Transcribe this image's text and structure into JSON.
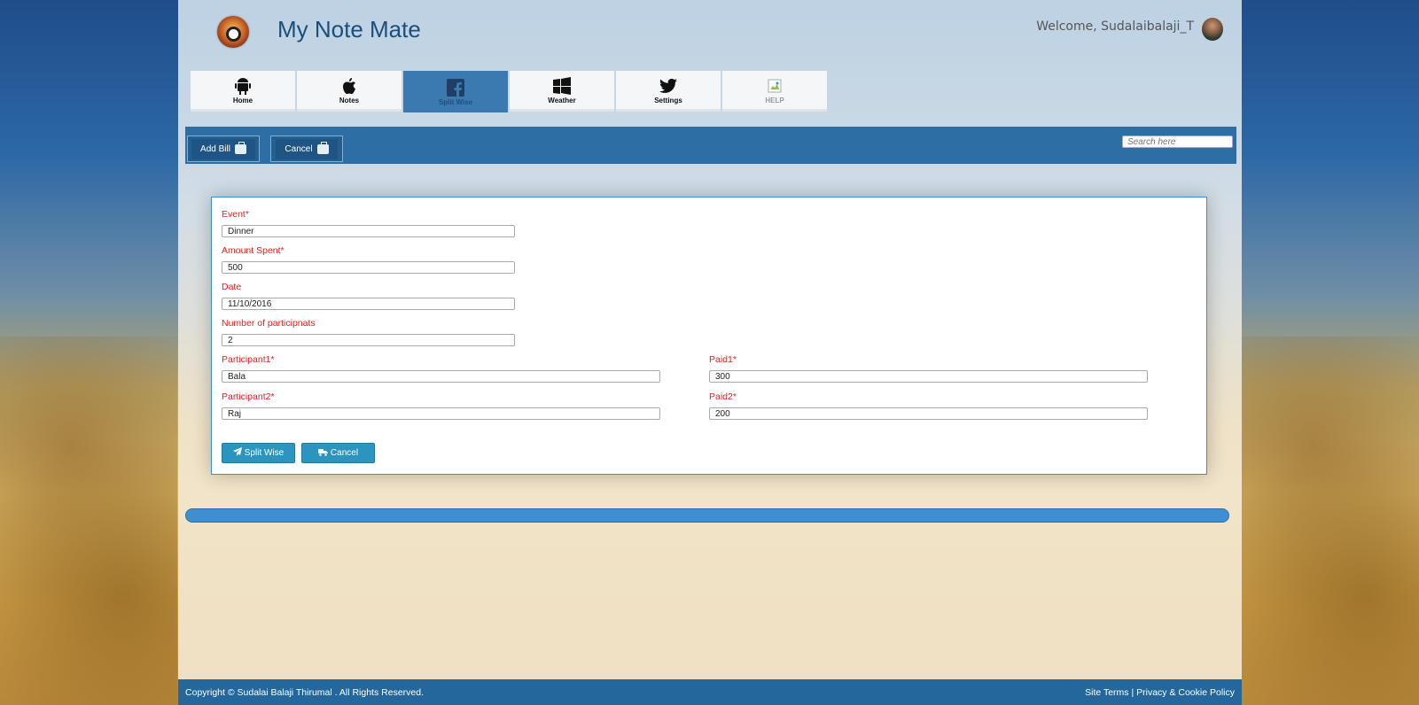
{
  "header": {
    "app_title": "My Note Mate",
    "welcome_text": "Welcome, Sudalaibalaji_T"
  },
  "nav": {
    "tabs": [
      {
        "label": "Home",
        "icon": "android-icon"
      },
      {
        "label": "Notes",
        "icon": "apple-icon"
      },
      {
        "label": "Split Wise",
        "icon": "facebook-icon",
        "active": true
      },
      {
        "label": "Weather",
        "icon": "windows-icon"
      },
      {
        "label": "Settings",
        "icon": "twitter-icon"
      },
      {
        "label": "HELP",
        "icon": "broken-image-icon"
      }
    ]
  },
  "toolbar": {
    "add_bill_label": "Add Bill",
    "cancel_label": "Cancel",
    "search_placeholder": "Search here"
  },
  "form": {
    "event_label": "Event",
    "event_value": "Dinner",
    "amount_label": "Amount Spent",
    "amount_value": "500",
    "date_label": "Date",
    "date_value": "11/10/2016",
    "participants_label": "Number of participnats",
    "participants_value": "2",
    "participant1_label": "Participant1",
    "participant1_value": "Bala",
    "paid1_label": "Paid1",
    "paid1_value": "300",
    "participant2_label": "Participant2",
    "participant2_value": "Raj",
    "paid2_label": "Paid2",
    "paid2_value": "200",
    "required_marker": "*",
    "split_button_label": "Split Wise",
    "cancel_button_label": "Cancel"
  },
  "progress": {
    "percent": 100,
    "color": "#3e8ed0"
  },
  "footer": {
    "copyright": "Copyright © Sudalai Balaji Thirumal . All Rights Reserved.",
    "site_terms": "Site Terms",
    "separator": "|",
    "privacy": "Privacy & Cookie Policy"
  },
  "colors": {
    "accent": "#2d6fa4",
    "label_red": "#e02020",
    "button_teal": "#2c95bf"
  }
}
